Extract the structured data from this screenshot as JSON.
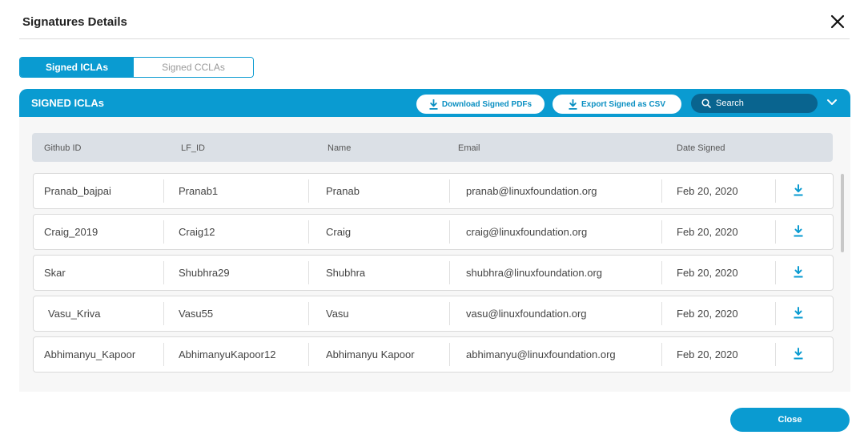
{
  "modal": {
    "title": "Signatures Details",
    "close_label": "Close"
  },
  "tabs": [
    {
      "label": "Signed ICLAs",
      "active": true
    },
    {
      "label": "Signed CCLAs",
      "active": false
    }
  ],
  "panel": {
    "title": "SIGNED ICLAs",
    "download_pdfs_label": "Download Signed PDFs",
    "export_csv_label": "Export Signed as CSV",
    "search_placeholder": "Search"
  },
  "table": {
    "columns": [
      "Github ID",
      "LF_ID",
      "Name",
      "Email",
      "Date Signed"
    ],
    "rows": [
      {
        "github_id": "Pranab_bajpai",
        "lf_id": "Pranab1",
        "name": "Pranab",
        "email": "pranab@linuxfoundation.org",
        "date": "Feb 20, 2020"
      },
      {
        "github_id": "Craig_2019",
        "lf_id": "Craig12",
        "name": "Craig",
        "email": "craig@linuxfoundation.org",
        "date": "Feb 20, 2020"
      },
      {
        "github_id": "Skar",
        "lf_id": "Shubhra29",
        "name": "Shubhra",
        "email": "shubhra@linuxfoundation.org",
        "date": "Feb 20, 2020"
      },
      {
        "github_id": "Vasu_Kriva",
        "lf_id": "Vasu55",
        "name": "Vasu",
        "email": "vasu@linuxfoundation.org",
        "date": "Feb 20, 2020"
      },
      {
        "github_id": "Abhimanyu_Kapoor",
        "lf_id": "AbhimanyuKapoor12",
        "name": "Abhimanyu Kapoor",
        "email": "abhimanyu@linuxfoundation.org",
        "date": "Feb 20, 2020"
      }
    ]
  },
  "icons": {
    "close": "close-icon",
    "download": "download-icon",
    "search": "search-icon",
    "chevron": "chevron-down-icon"
  },
  "colors": {
    "accent": "#0a9bd1",
    "search_bg": "#09648f",
    "header_row": "#dbe0e6"
  }
}
